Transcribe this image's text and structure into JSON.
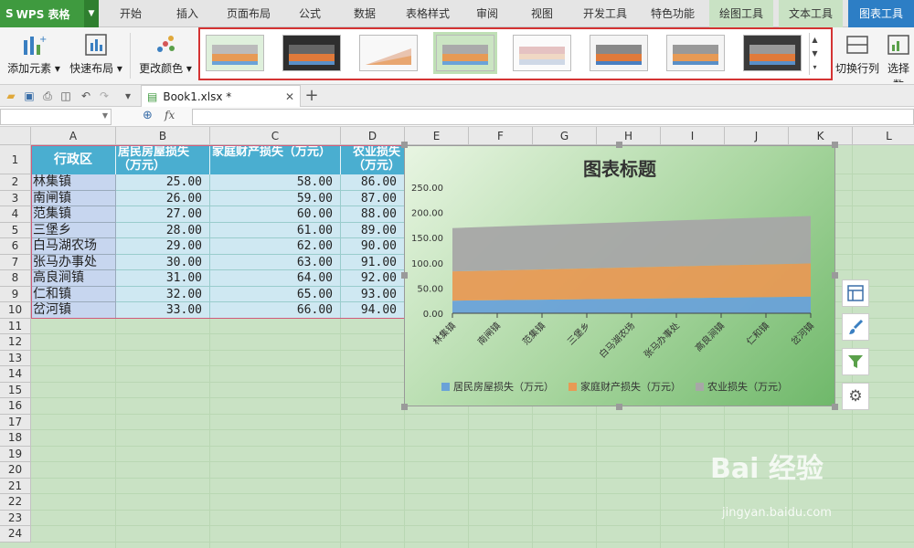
{
  "app": {
    "name": "WPS 表格"
  },
  "menu": {
    "tabs": [
      "开始",
      "插入",
      "页面布局",
      "公式",
      "数据",
      "表格样式",
      "审阅",
      "视图",
      "开发工具",
      "特色功能",
      "绘图工具",
      "文本工具",
      "图表工具"
    ],
    "active": "图表工具"
  },
  "ribbon": {
    "add_element": "添加元素",
    "quick_layout": "快速布局",
    "change_color": "更改颜色",
    "switch_rowcol": "切换行列",
    "select_data": "选择数"
  },
  "file": {
    "tab_name": "Book1.xlsx *",
    "new_tab": "+"
  },
  "formula": {
    "fx": "fx"
  },
  "columns": [
    "A",
    "B",
    "C",
    "D",
    "E",
    "F",
    "G",
    "H",
    "I",
    "J",
    "K",
    "L"
  ],
  "rows": [
    "1",
    "2",
    "3",
    "4",
    "5",
    "6",
    "7",
    "8",
    "9",
    "10",
    "11",
    "12",
    "13",
    "14",
    "15",
    "16",
    "17",
    "18",
    "19",
    "20",
    "21",
    "22",
    "23",
    "24"
  ],
  "table": {
    "headers": [
      "行政区",
      "居民房屋损失（万元）",
      "家庭财产损失（万元）",
      "农业损失（万元）"
    ],
    "rows": [
      [
        "林集镇",
        "25.00",
        "58.00",
        "86.00"
      ],
      [
        "南闸镇",
        "26.00",
        "59.00",
        "87.00"
      ],
      [
        "范集镇",
        "27.00",
        "60.00",
        "88.00"
      ],
      [
        "三堡乡",
        "28.00",
        "61.00",
        "89.00"
      ],
      [
        "白马湖农场",
        "29.00",
        "62.00",
        "90.00"
      ],
      [
        "张马办事处",
        "30.00",
        "63.00",
        "91.00"
      ],
      [
        "高良涧镇",
        "31.00",
        "64.00",
        "92.00"
      ],
      [
        "仁和镇",
        "32.00",
        "65.00",
        "93.00"
      ],
      [
        "岔河镇",
        "33.00",
        "66.00",
        "94.00"
      ]
    ]
  },
  "chart_data": {
    "type": "area",
    "stacked": true,
    "title": "图表标题",
    "categories": [
      "林集镇",
      "南闸镇",
      "范集镇",
      "三堡乡",
      "白马湖农场",
      "张马办事处",
      "高良涧镇",
      "仁和镇",
      "岔河镇"
    ],
    "series": [
      {
        "name": "居民房屋损失（万元）",
        "values": [
          25,
          26,
          27,
          28,
          29,
          30,
          31,
          32,
          33
        ],
        "color": "#6aa2d8"
      },
      {
        "name": "家庭财产损失（万元）",
        "values": [
          58,
          59,
          60,
          61,
          62,
          63,
          64,
          65,
          66
        ],
        "color": "#e79a55"
      },
      {
        "name": "农业损失（万元）",
        "values": [
          86,
          87,
          88,
          89,
          90,
          91,
          92,
          93,
          94
        ],
        "color": "#a7a7a7"
      }
    ],
    "y_ticks": [
      "0.00",
      "50.00",
      "100.00",
      "150.00",
      "200.00",
      "250.00"
    ],
    "ylim": [
      0,
      250
    ],
    "grid": false,
    "legend_position": "bottom"
  },
  "watermark": {
    "brand": "Bai 经验",
    "url": "jingyan.baidu.com"
  },
  "colors": {
    "app_green": "#3f9a3f",
    "active_tab": "#2d7ec5",
    "header_fill": "#4aaed0",
    "sheet_bg": "#c9e2c4",
    "highlight_red": "#d43333"
  }
}
